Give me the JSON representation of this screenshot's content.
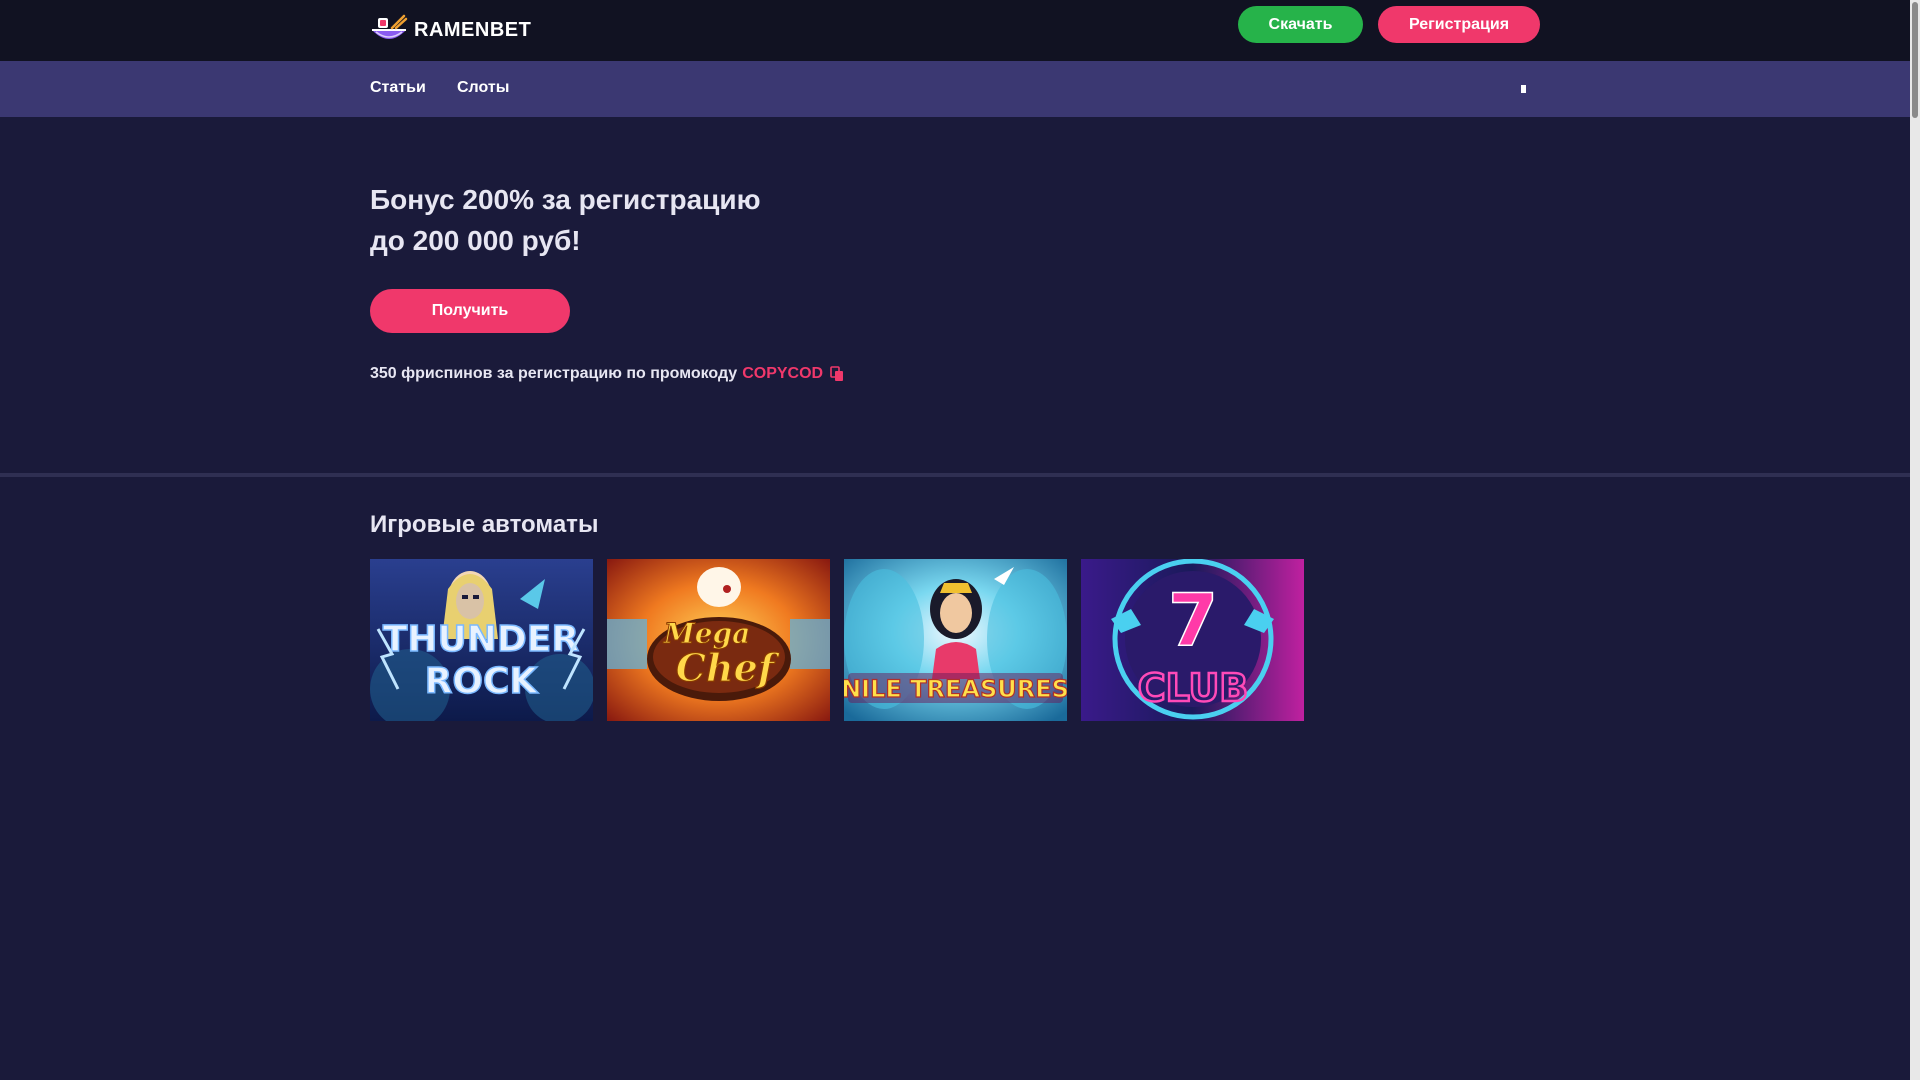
{
  "header": {
    "logo_text": "RAMENBET",
    "download_label": "Скачать",
    "register_label": "Регистрация"
  },
  "nav": {
    "items": [
      {
        "label": "Статьи"
      },
      {
        "label": "Слоты"
      }
    ],
    "search_icon": "search-icon"
  },
  "hero": {
    "title_line1": "Бонус 200% за регистрацию",
    "title_line2": "до 200 000 руб!",
    "cta_label": "Получить",
    "promo_text": "350 фриспинов за регистрацию по промокоду",
    "promo_code": "COPYCOD"
  },
  "slots": {
    "title": "Игровые автоматы",
    "games": [
      {
        "name": "THUNDER ROCK",
        "line1": "THUNDER",
        "line2": "ROCK"
      },
      {
        "name": "Mega Chef",
        "line1": "Mega",
        "line2": "Chef"
      },
      {
        "name": "NILE TREASURES",
        "line1": "NILE TREASURES"
      },
      {
        "name": "7 CLUB",
        "line1": "7",
        "line2": "CLUB"
      }
    ]
  },
  "colors": {
    "topbar": "#111222",
    "navbar": "#3b3872",
    "background": "#1a1a3a",
    "accent_pink": "#f0386b",
    "accent_green": "#26b34a"
  }
}
